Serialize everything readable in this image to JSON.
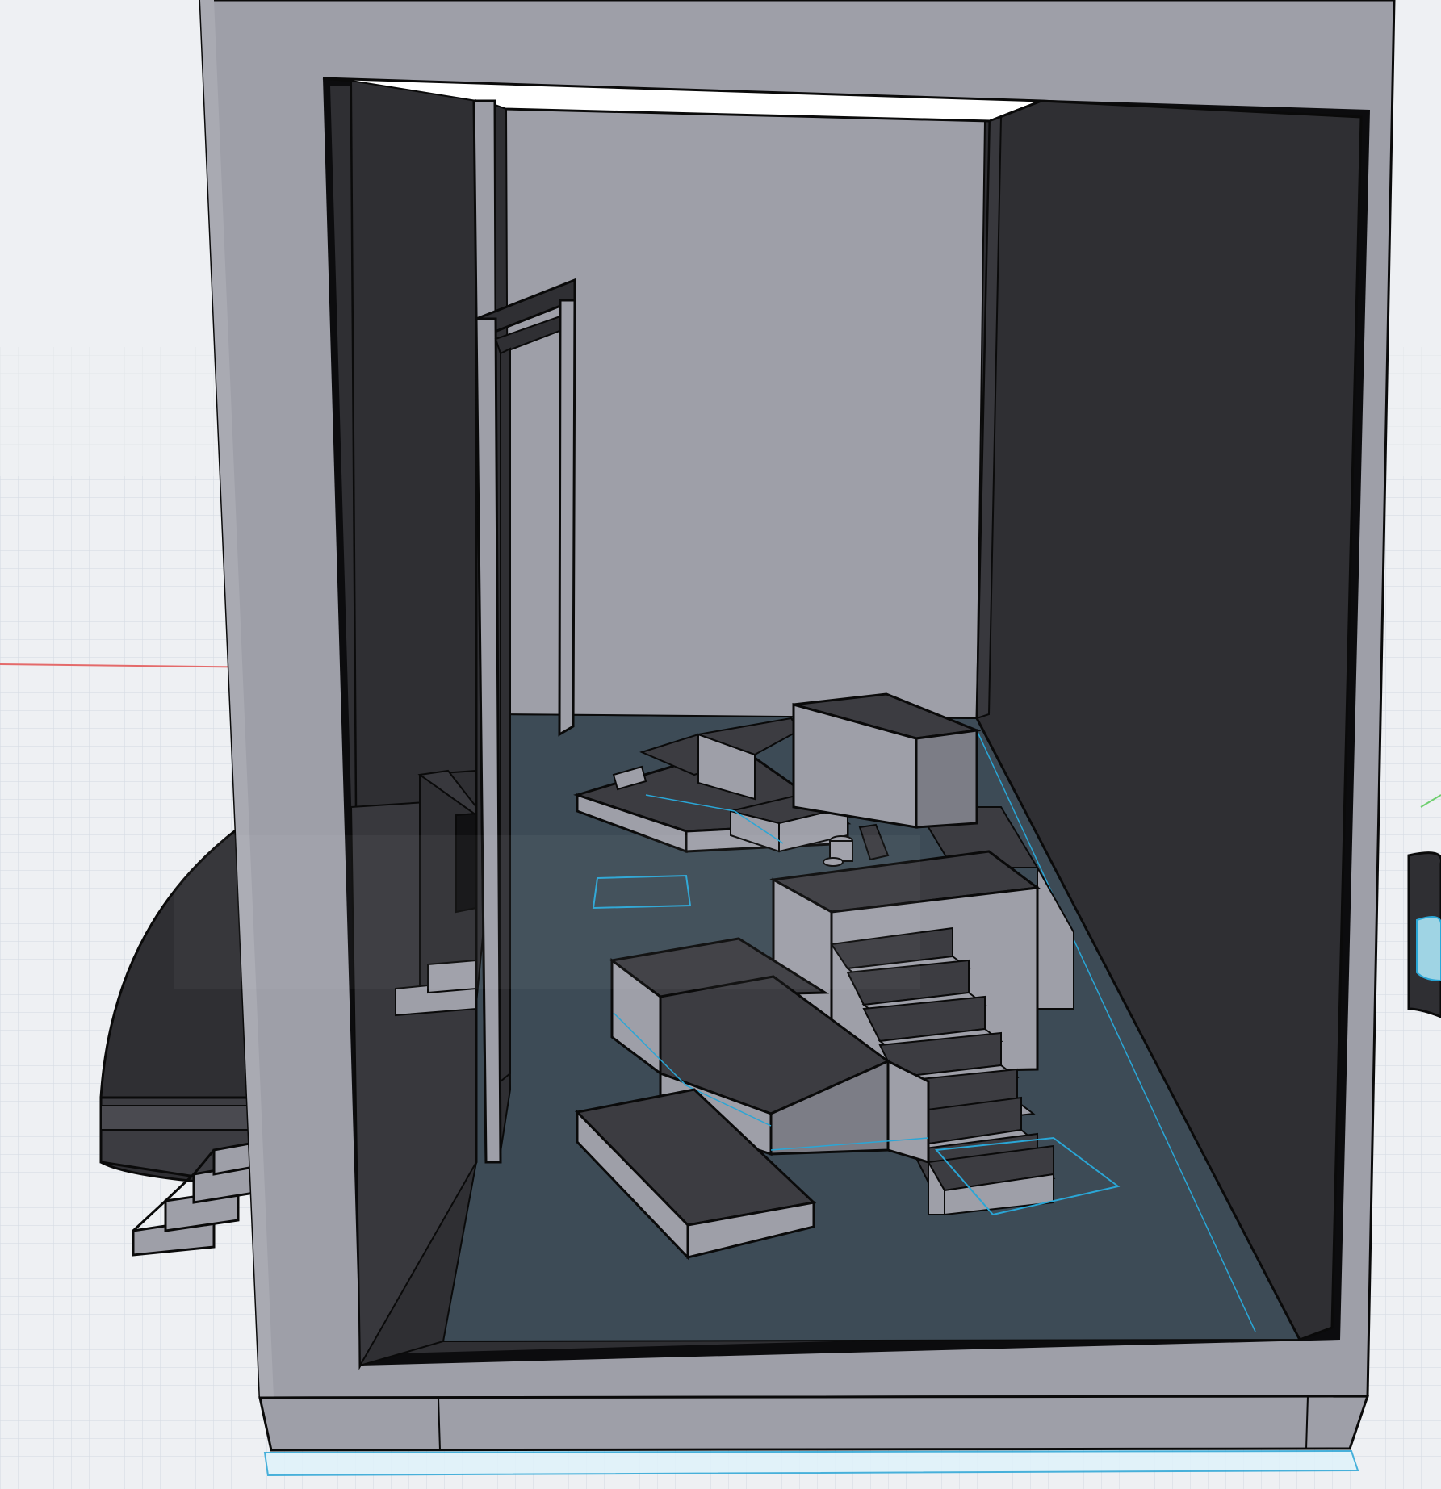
{
  "viewport": {
    "kind": "3d-modeling-viewport",
    "view": "perspective",
    "background_color": "#eef0f3",
    "grid_color": "#d0d6df",
    "x_axis_color": "#e46a6a",
    "y_axis_color": "#6fcf6f",
    "selection_color": "#2aa6d6"
  },
  "model": {
    "wall_color": "#9e9fa8",
    "wall_shadow_color": "#7c7d86",
    "dark_face_color": "#2f2f33",
    "floor_color": "#3d4b56",
    "edge_color": "#0a0a0a",
    "objects": [
      "outer-shell",
      "opening-frame",
      "back-wall",
      "right-wall-dark",
      "door-frame",
      "curved-base-left",
      "exterior-stairs-left",
      "bench-left",
      "tall-block",
      "stepped-platform",
      "stair-tower",
      "seat-block-front",
      "low-block-front",
      "side-block-right",
      "small-cylinders",
      "base-plinth"
    ]
  }
}
